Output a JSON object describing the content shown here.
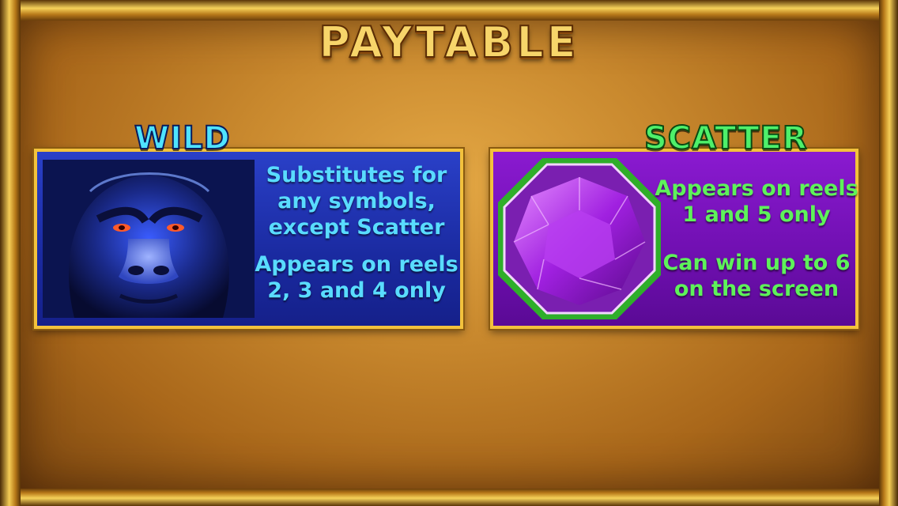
{
  "title": "PAYTABLE",
  "wild": {
    "label": "WILD",
    "lines1": [
      "Substitutes for",
      "any symbols,",
      "except Scatter"
    ],
    "lines2": [
      "Appears on reels",
      "2, 3 and 4 only"
    ],
    "icon": "gorilla-face",
    "color": "#4fe3ff"
  },
  "scatter": {
    "label": "SCATTER",
    "lines1": [
      "Appears on reels",
      "1 and 5 only"
    ],
    "lines2": [
      "Can win up to 6",
      "on the screen"
    ],
    "icon": "purple-gem",
    "color": "#4ef06a"
  }
}
